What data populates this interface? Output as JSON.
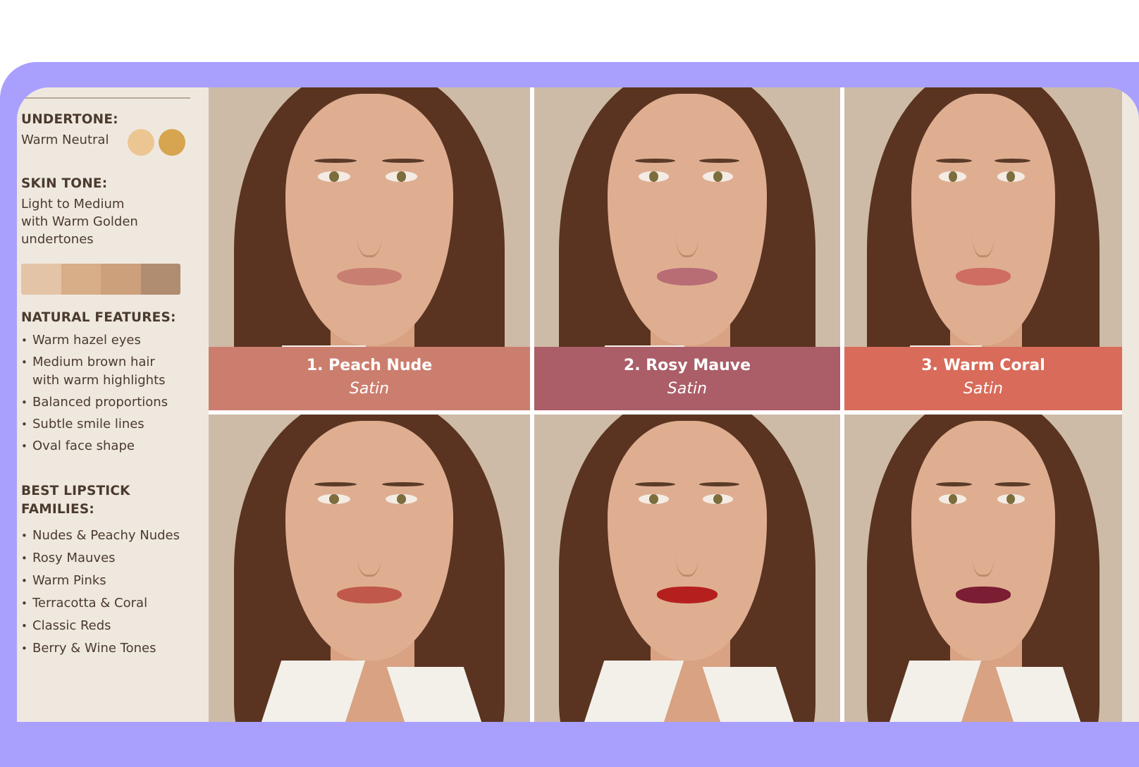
{
  "window": {
    "dots": [
      "window-dot",
      "window-dot",
      "window-dot"
    ]
  },
  "sidebar": {
    "undertone": {
      "heading": "UNDERTONE:",
      "value": "Warm Neutral",
      "swatches": [
        "#ecc692",
        "#d7a54f"
      ]
    },
    "skin_tone": {
      "heading": "SKIN TONE:",
      "lines": [
        "Light to Medium",
        "with Warm Golden",
        "undertones"
      ],
      "strip": [
        "#e4c4a6",
        "#d7ae88",
        "#cda07c",
        "#b08c70"
      ]
    },
    "natural_features": {
      "heading": "NATURAL FEATURES:",
      "items": [
        {
          "line1": "Warm hazel eyes"
        },
        {
          "line1": "Medium brown hair",
          "line2": "with warm highlights"
        },
        {
          "line1": "Balanced proportions"
        },
        {
          "line1": "Subtle smile lines"
        },
        {
          "line1": "Oval face shape"
        }
      ]
    },
    "best_lipstick": {
      "heading_line1": "BEST LIPSTICK",
      "heading_line2": "FAMILIES:",
      "items": [
        "Nudes & Peachy Nudes",
        "Rosy Mauves",
        "Warm Pinks",
        "Terracotta & Coral",
        "Classic Reds",
        "Berry & Wine Tones"
      ]
    }
  },
  "grid": {
    "cells": [
      {
        "label": "1. Peach Nude",
        "finish": "Satin",
        "label_color": "#cc7e6e",
        "lip_color": "#c97e72"
      },
      {
        "label": "2. Rosy Mauve",
        "finish": "Satin",
        "label_color": "#ab5d68",
        "lip_color": "#b86c74"
      },
      {
        "label": "3. Warm Coral",
        "finish": "Satin",
        "label_color": "#d96b5a",
        "lip_color": "#cf6d62"
      },
      {
        "lip_color": "#c0584c"
      },
      {
        "lip_color": "#b5201f"
      },
      {
        "lip_color": "#7b1d33"
      }
    ]
  }
}
